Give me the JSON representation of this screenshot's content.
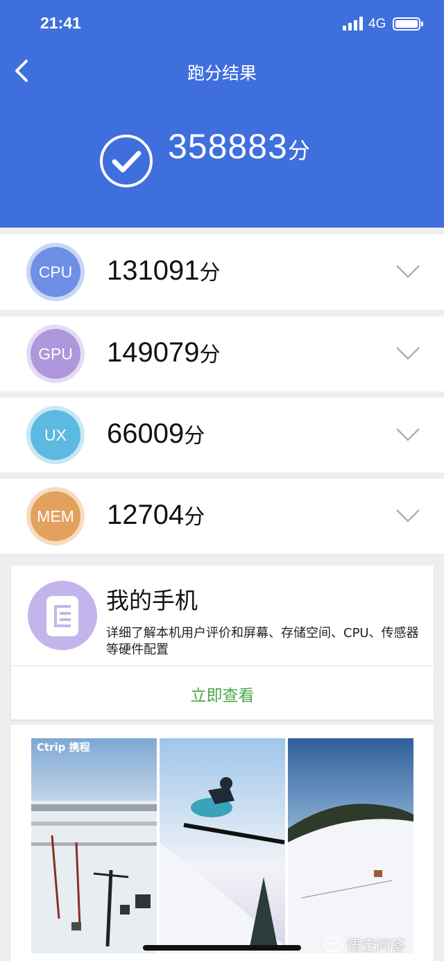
{
  "status_bar": {
    "time": "21:41",
    "network": "4G"
  },
  "header": {
    "title": "跑分结果",
    "total_score": "358883",
    "unit": "分"
  },
  "rows": [
    {
      "label": "CPU",
      "score": "131091",
      "unit": "分",
      "color": "#6d8fe6",
      "ring": "#c9d6f6"
    },
    {
      "label": "GPU",
      "score": "149079",
      "unit": "分",
      "color": "#ae97dc",
      "ring": "#e4dbf3"
    },
    {
      "label": "UX",
      "score": "66009",
      "unit": "分",
      "color": "#5cb9e0",
      "ring": "#c8e8f5"
    },
    {
      "label": "MEM",
      "score": "12704",
      "unit": "分",
      "color": "#e3a15e",
      "ring": "#f6dcc0"
    }
  ],
  "card": {
    "title": "我的手机",
    "description": "详细了解本机用户评价和屏幕、存储空间、CPU、传感器等硬件配置",
    "action": "立即查看"
  },
  "ad": {
    "logo": "Ctrip 携程"
  },
  "watermark": "悟空问答",
  "colors": {
    "header": "#3f6fdd",
    "action": "#4aa54a"
  }
}
